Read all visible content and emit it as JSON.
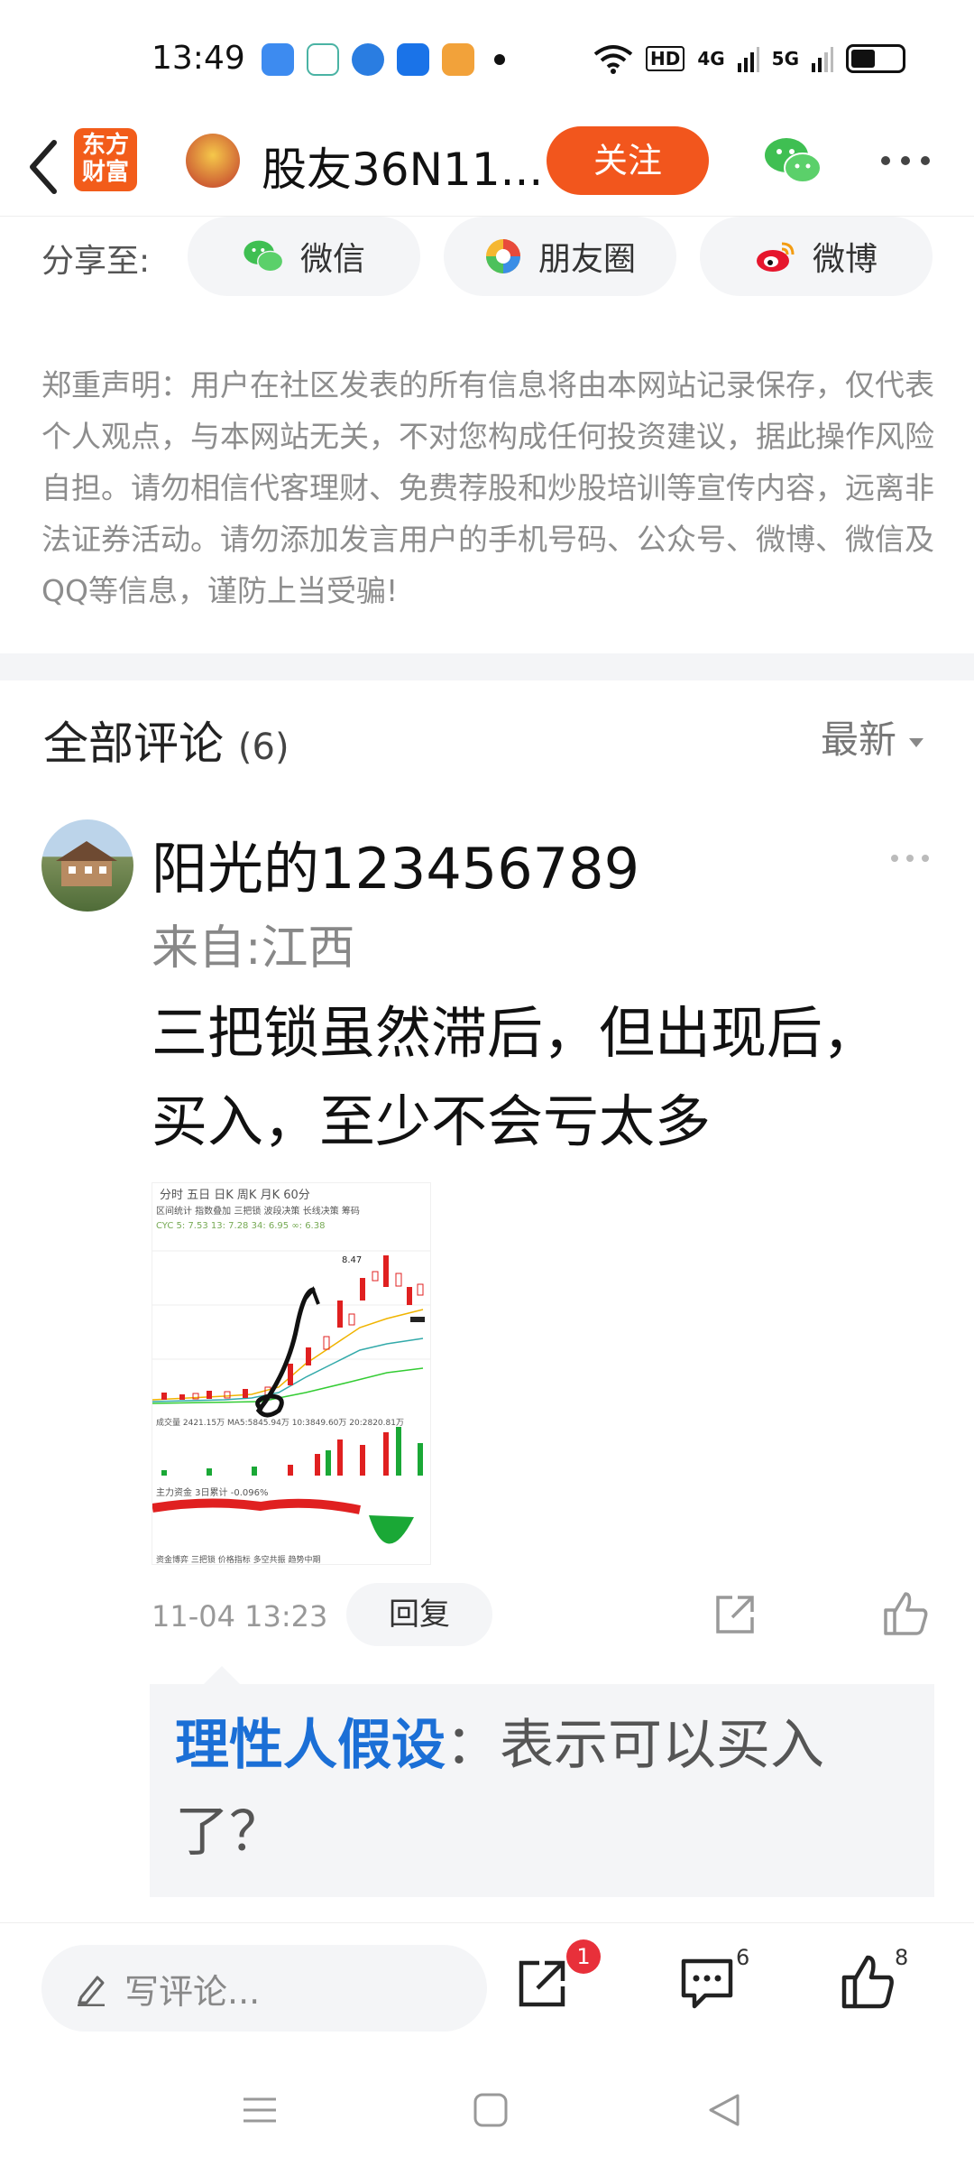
{
  "status_bar": {
    "time": "13:49",
    "network_1": "HD",
    "network_2": "4G",
    "network_3": "5G"
  },
  "header": {
    "logo_line1": "东方",
    "logo_line2": "财富",
    "title": "股友36N11...",
    "follow_label": "关注"
  },
  "share": {
    "label": "分享至:",
    "items": [
      {
        "label": "微信",
        "icon": "wechat-icon"
      },
      {
        "label": "朋友圈",
        "icon": "moments-icon"
      },
      {
        "label": "微博",
        "icon": "weibo-icon"
      }
    ]
  },
  "disclaimer": "郑重声明：用户在社区发表的所有信息将由本网站记录保存，仅代表个人观点，与本网站无关，不对您构成任何投资建议，据此操作风险自担。请勿相信代客理财、免费荐股和炒股培训等宣传内容，远离非法证券活动。请勿添加发言用户的手机号码、公众号、微博、微信及QQ等信息，谨防上当受骗!",
  "comments": {
    "title": "全部评论",
    "count": "(6)",
    "sort_label": "最新",
    "items": [
      {
        "user": "阳光的123456789",
        "location": "来自:江西",
        "text": "三把锁虽然滞后，但出现后，买入，至少不会亏太多",
        "time": "11-04 13:23",
        "reply_label": "回复",
        "chart_tabs": "分时  五日  日K  周K  月K  60分",
        "chart_tools": "区间统计 指数叠加 三把锁 波段决策 长线决策 筹码",
        "chart_legend": "CYC 5: 7.53  13: 7.28  34: 6.95  ∞: 6.38",
        "chart_peak": "8.47",
        "chart_volume": "成交量  2421.15万  MA5:5845.94万  10:3849.60万  20:2820.81万",
        "chart_fund": "主力资金  3日累计  -0.096%",
        "chart_bottom": "资金博弈  三把锁  价格指标  多空共振  趋势中期",
        "reply": {
          "author": "理性人假设",
          "text": "：表示可以买入了？"
        }
      }
    ]
  },
  "bottom_bar": {
    "input_placeholder": "写评论...",
    "share_badge": "1",
    "comment_count": "6",
    "like_count": "8"
  }
}
